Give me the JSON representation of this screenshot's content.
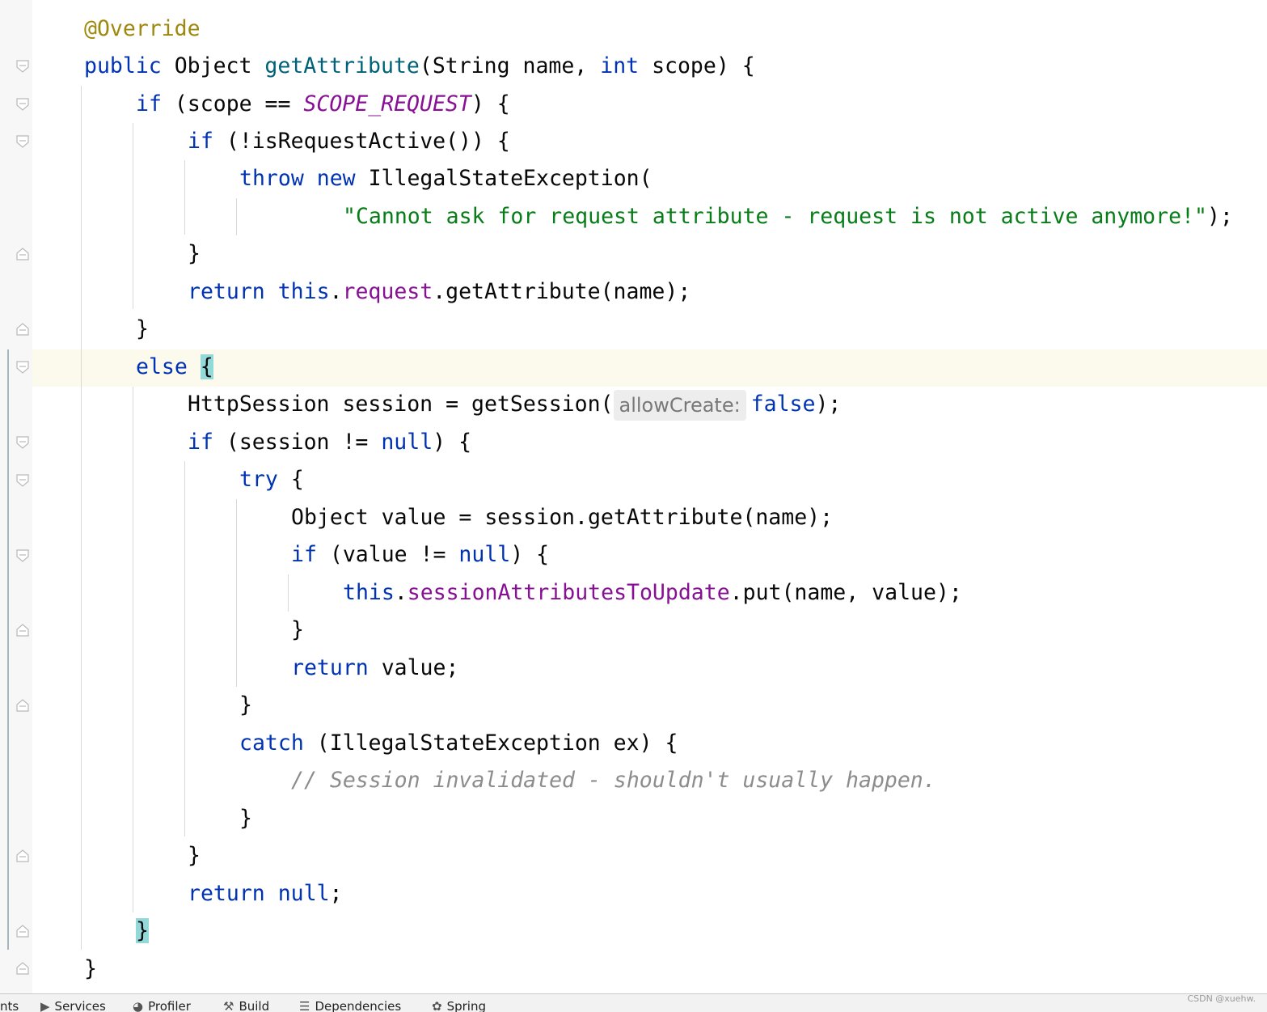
{
  "editor": {
    "lines": {
      "l1": {
        "annotation": "@Override"
      },
      "l2": {
        "kw_public": "public",
        "type": "Object",
        "method": "getAttribute",
        "params_open": "(String name, ",
        "kw_int": "int",
        "params_close": " scope) {"
      },
      "l3": {
        "kw_if": "if",
        "cond_open": " (scope == ",
        "const": "SCOPE_REQUEST",
        "cond_close": ") {"
      },
      "l4": {
        "kw_if": "if",
        "rest": " (!isRequestActive()) {"
      },
      "l5": {
        "kw_throw": "throw",
        "sp": " ",
        "kw_new": "new",
        "rest": " IllegalStateException("
      },
      "l6": {
        "string": "\"Cannot ask for request attribute - request is not active anymore!\"",
        "rest": ");"
      },
      "l7": {
        "text": "}"
      },
      "l8": {
        "kw_return": "return",
        "sp": " ",
        "kw_this": "this",
        "dot": ".",
        "field": "request",
        "rest": ".getAttribute(name);"
      },
      "l9": {
        "text": "}"
      },
      "l10": {
        "kw_else": "else",
        "sp": " ",
        "brace": "{"
      },
      "l11": {
        "text": "HttpSession session = getSession(",
        "hint": "allowCreate:",
        "kw_false": "false",
        "rest": ");"
      },
      "l12": {
        "kw_if": "if",
        "cond": " (session != ",
        "kw_null": "null",
        "rest": ") {"
      },
      "l13": {
        "kw_try": "try",
        "rest": " {"
      },
      "l14": {
        "text": "Object value = session.getAttribute(name);"
      },
      "l15": {
        "kw_if": "if",
        "cond": " (value != ",
        "kw_null": "null",
        "rest": ") {"
      },
      "l16": {
        "kw_this": "this",
        "dot": ".",
        "field": "sessionAttributesToUpdate",
        "rest": ".put(name, value);"
      },
      "l17": {
        "text": "}"
      },
      "l18": {
        "kw_return": "return",
        "rest": " value;"
      },
      "l19": {
        "text": "}"
      },
      "l20": {
        "kw_catch": "catch",
        "rest": " (IllegalStateException ex) {"
      },
      "l21": {
        "comment": "// Session invalidated - shouldn't usually happen."
      },
      "l22": {
        "text": "}"
      },
      "l23": {
        "text": "}"
      },
      "l24": {
        "kw_return": "return",
        "sp": " ",
        "kw_null": "null",
        "rest": ";"
      },
      "l25": {
        "brace": "}"
      },
      "l26": {
        "text": "}"
      }
    }
  },
  "bottom_bar": {
    "tabs": [
      {
        "label": "nts",
        "icon": "none"
      },
      {
        "label": "Services",
        "icon": "services-icon"
      },
      {
        "label": "Profiler",
        "icon": "profiler-icon"
      },
      {
        "label": "Build",
        "icon": "hammer-icon"
      },
      {
        "label": "Dependencies",
        "icon": "layers-icon"
      },
      {
        "label": "Spring",
        "icon": "leaf-icon"
      }
    ]
  },
  "watermark": "CSDN @xuehw.",
  "colors": {
    "keyword": "#0033b3",
    "annotation": "#9e880d",
    "method": "#00627a",
    "field": "#871094",
    "string": "#067d17",
    "comment": "#8c8c8c",
    "brace_highlight": "#93d9d9",
    "caret_line": "#fcfaed"
  }
}
